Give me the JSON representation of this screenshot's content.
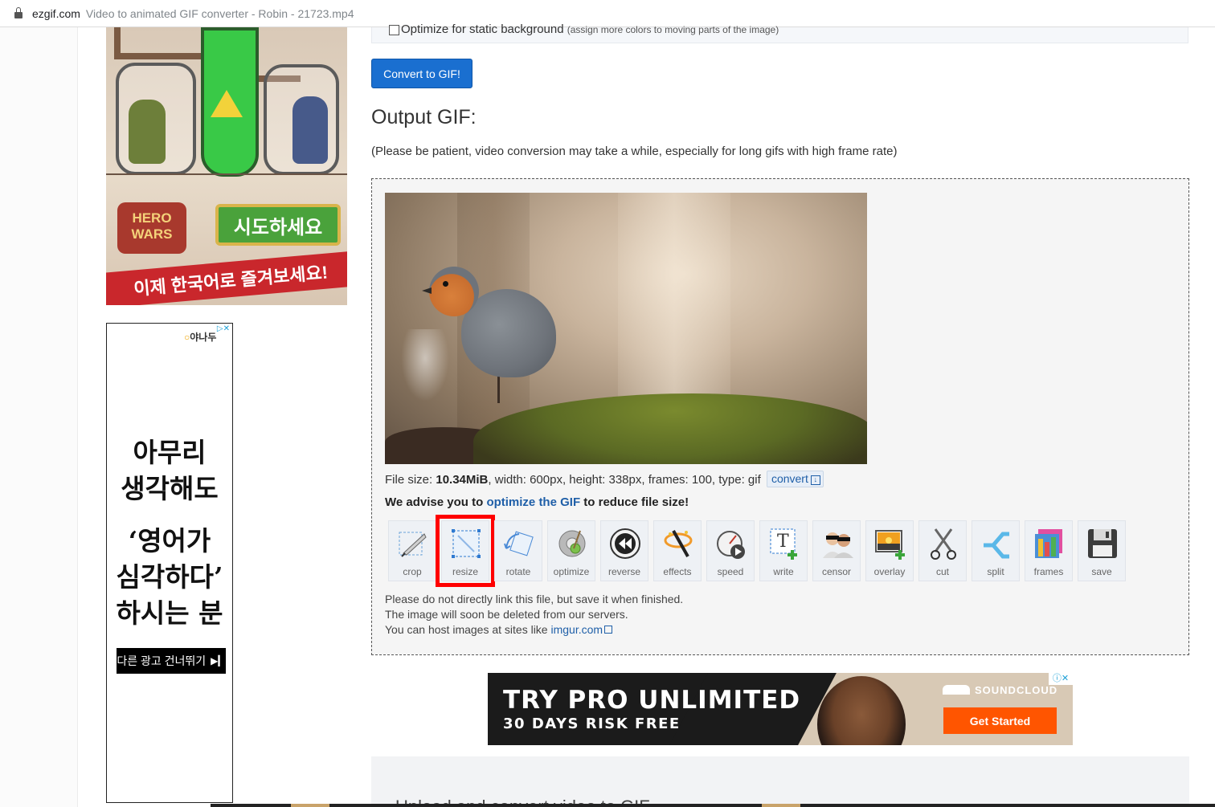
{
  "browser": {
    "domain": "ezgif.com",
    "title": "Video to animated GIF converter - Robin - 21723.mp4"
  },
  "ads": {
    "game": {
      "logo_text": "HERO WARS",
      "cta": "시도하세요",
      "banner": "이제 한국어로 즐겨보세요!"
    },
    "text_ad": {
      "brand": "야나두",
      "headline_lines": [
        "아무리",
        "생각해도",
        "‘영어가",
        "심각하다’",
        "하시는 분"
      ],
      "skip_label": "다른 광고 건너뛰기"
    },
    "soundcloud": {
      "line1": "TRY PRO UNLIMITED",
      "line2": "30 DAYS RISK FREE",
      "logo": "SOUNDCLOUD",
      "button": "Get Started"
    }
  },
  "options": {
    "static_bg_label": "Optimize for static background",
    "static_bg_hint": "(assign more colors to moving parts of the image)",
    "static_bg_checked": false
  },
  "convert_button": "Convert to GIF!",
  "output": {
    "heading": "Output GIF:",
    "patience_note": "(Please be patient, video conversion may take a while, especially for long gifs with high frame rate)",
    "file_size_label": "File size: ",
    "file_size": "10.34MiB",
    "file_details": ", width: 600px, height: 338px, frames: 100, type: gif",
    "convert_link": "convert",
    "advise_prefix": "We advise you to ",
    "advise_link": "optimize the GIF",
    "advise_suffix": " to reduce file size!",
    "tools": [
      {
        "label": "crop",
        "icon": "crop-icon"
      },
      {
        "label": "resize",
        "icon": "resize-icon",
        "highlighted": true
      },
      {
        "label": "rotate",
        "icon": "rotate-icon"
      },
      {
        "label": "optimize",
        "icon": "optimize-icon"
      },
      {
        "label": "reverse",
        "icon": "reverse-icon"
      },
      {
        "label": "effects",
        "icon": "effects-icon"
      },
      {
        "label": "speed",
        "icon": "speed-icon"
      },
      {
        "label": "write",
        "icon": "write-icon"
      },
      {
        "label": "censor",
        "icon": "censor-icon"
      },
      {
        "label": "overlay",
        "icon": "overlay-icon"
      },
      {
        "label": "cut",
        "icon": "cut-icon"
      },
      {
        "label": "split",
        "icon": "split-icon"
      },
      {
        "label": "frames",
        "icon": "frames-icon"
      },
      {
        "label": "save",
        "icon": "save-icon"
      }
    ],
    "notes": {
      "line1": "Please do not directly link this file, but save it when finished.",
      "line2": "The image will soon be deleted from our servers.",
      "line3_prefix": "You can host images at sites like ",
      "line3_link": "imgur.com"
    }
  },
  "upload_section_title": "Upload and convert video to GIF",
  "colors": {
    "accent": "#1a6fd0",
    "highlight": "#ff0000",
    "soundcloud": "#ff5500"
  }
}
